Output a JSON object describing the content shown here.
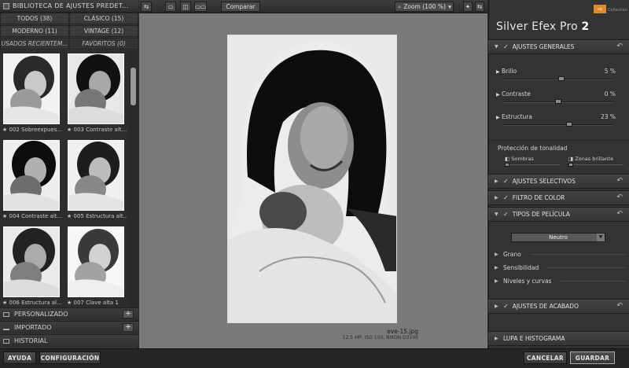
{
  "library": {
    "title": "BIBLIOTECA DE AJUSTES PREDET...",
    "tabs": [
      "TODOS (38)",
      "CLÁSICO (15)",
      "MODERNO (11)",
      "VINTAGE (12)"
    ],
    "tabs2": [
      "USADOS RECIENTEM...",
      "FAVORITOS (0)"
    ],
    "thumbs": [
      "002 Sobreexpues...",
      "003 Contraste alt...",
      "004 Contraste alt...",
      "005 Estructura alt...",
      "006 Estructura al...",
      "007 Clave alta 1"
    ],
    "sections": [
      "PERSONALIZADO",
      "IMPORTADO",
      "HISTORIAL"
    ]
  },
  "toolbar": {
    "compare": "Comparar",
    "zoom": "Zoom (100 %)"
  },
  "photo": {
    "name": "eve-15.jpg",
    "info": "12.5 MP, ISO 100, NIKON D3100"
  },
  "right": {
    "brand_logo": "nik",
    "brand_sub": "Collection",
    "product_name": "Silver Efex Pro",
    "product_version": "2",
    "general": {
      "title": "AJUSTES GENERALES",
      "sliders": [
        {
          "label": "Brillo",
          "value": "5 %",
          "level": 0.53
        },
        {
          "label": "Contraste",
          "value": "0 %",
          "level": 0.5
        },
        {
          "label": "Estructura",
          "value": "23 %",
          "level": 0.6
        }
      ],
      "tonality_title": "Protección de tonalidad",
      "tonality": [
        "Sombras",
        "Zonas brillante"
      ]
    },
    "selective": "AJUSTES SELECTIVOS",
    "color_filter": "FILTRO DE COLOR",
    "film": {
      "title": "TIPOS DE PELÍCULA",
      "preset": "Neutro",
      "rows": [
        "Grano",
        "Sensibilidad",
        "Niveles y curvas"
      ]
    },
    "finishing": "AJUSTES DE ACABADO",
    "loupe": "LUPA E HISTOGRAMA"
  },
  "bottom": {
    "help": "AYUDA",
    "config": "CONFIGURACIÓN",
    "cancel": "CANCELAR",
    "save": "GUARDAR"
  },
  "colors": {
    "panel": "#333333",
    "canvas": "#7a7a7a",
    "brand_accent": "#e08a20"
  }
}
